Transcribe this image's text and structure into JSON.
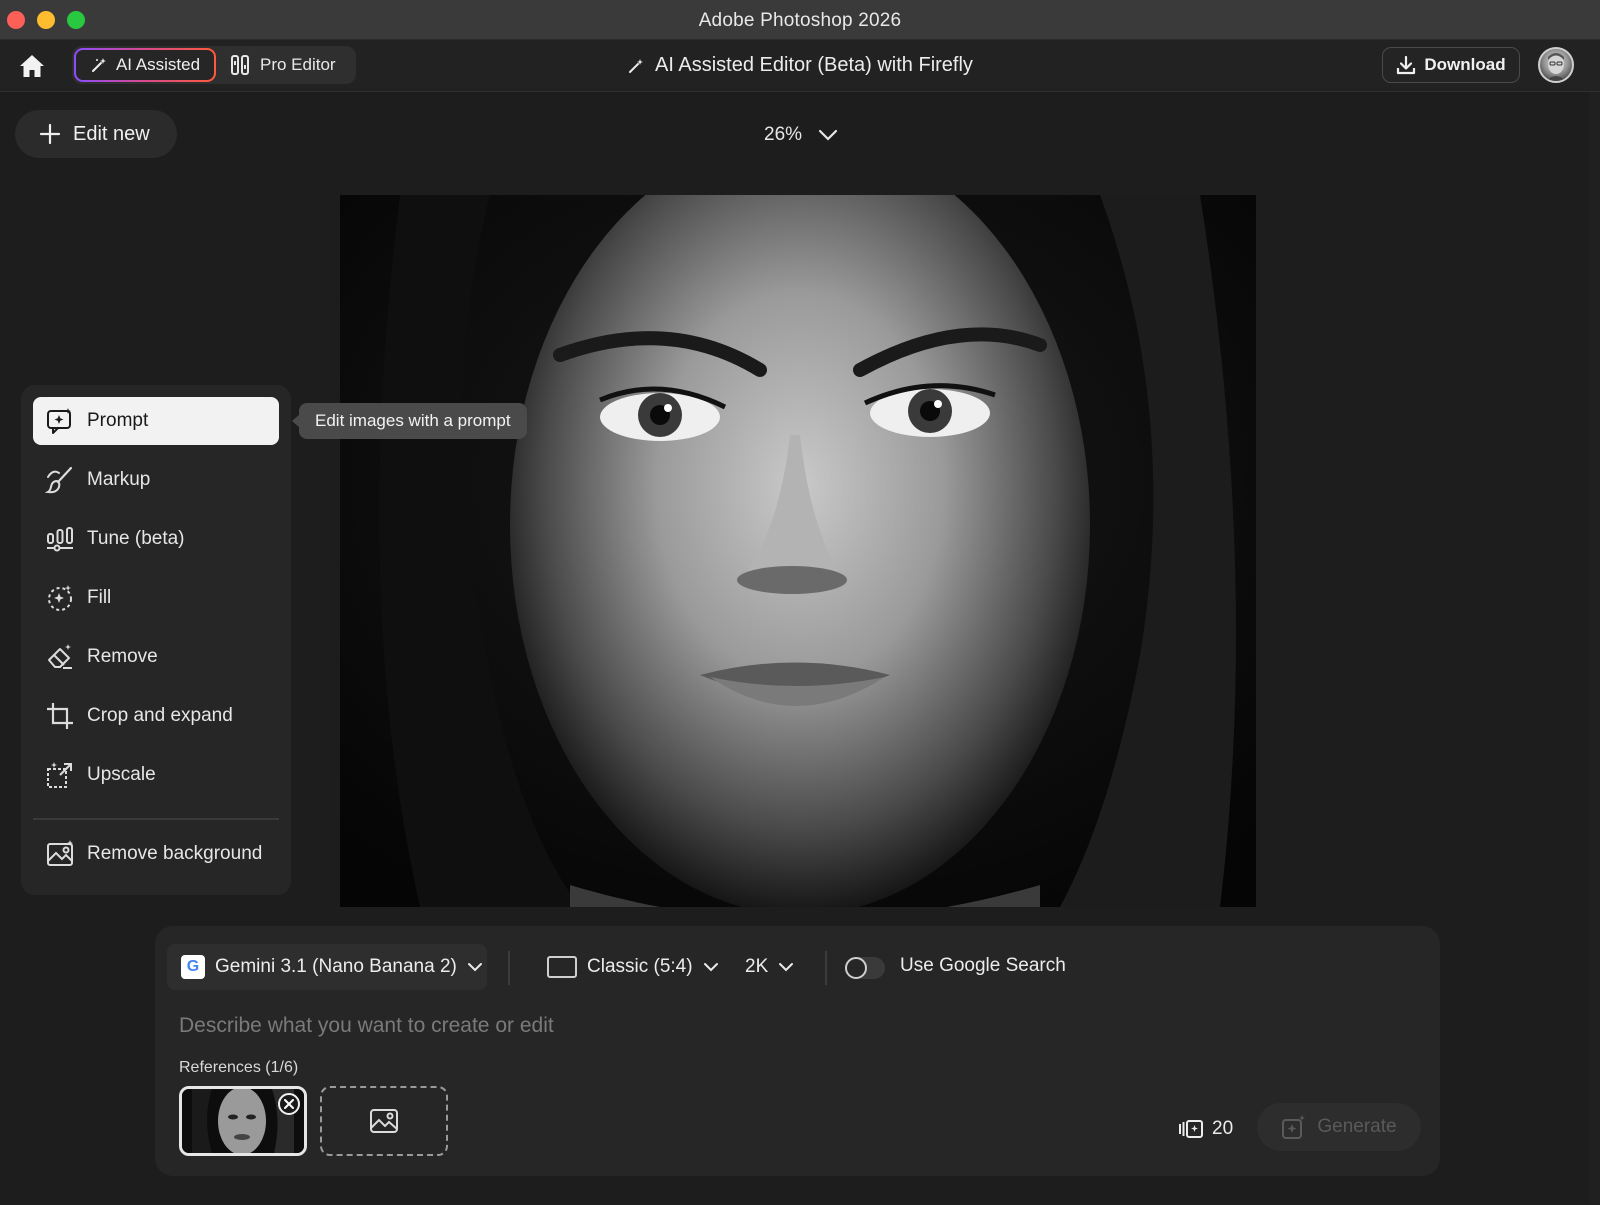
{
  "window": {
    "title": "Adobe Photoshop 2026"
  },
  "header": {
    "mode_ai": "AI Assisted",
    "mode_pro": "Pro Editor",
    "title": "AI Assisted Editor (Beta) with Firefly",
    "download_label": "Download"
  },
  "toolbar": {
    "edit_new_label": "Edit new",
    "zoom": "26%"
  },
  "tools": {
    "items": [
      {
        "label": "Prompt",
        "icon": "prompt-sparkle-icon",
        "active": true
      },
      {
        "label": "Markup",
        "icon": "brush-icon"
      },
      {
        "label": "Tune (beta)",
        "icon": "tune-sliders-icon"
      },
      {
        "label": "Fill",
        "icon": "generative-fill-icon"
      },
      {
        "label": "Remove",
        "icon": "eraser-icon"
      },
      {
        "label": "Crop and expand",
        "icon": "crop-icon"
      },
      {
        "label": "Upscale",
        "icon": "upscale-icon"
      },
      {
        "label": "Remove background",
        "icon": "remove-background-icon"
      }
    ],
    "tooltip": "Edit images with a prompt"
  },
  "prompt": {
    "model": "Gemini 3.1 (Nano Banana 2)",
    "model_logo": "G",
    "aspect": "Classic (5:4)",
    "resolution": "2K",
    "google_search_label": "Use Google Search",
    "google_search_enabled": false,
    "placeholder": "Describe what you want to create or edit",
    "value": "",
    "references_label": "References (1/6)",
    "credits": "20",
    "generate_label": "Generate"
  },
  "colors": {
    "background": "#1d1d1d",
    "panel": "#262626",
    "active_item": "#f2f2f2",
    "ai_gradient_start": "#8a4dff",
    "ai_gradient_end": "#ff5a3c"
  }
}
